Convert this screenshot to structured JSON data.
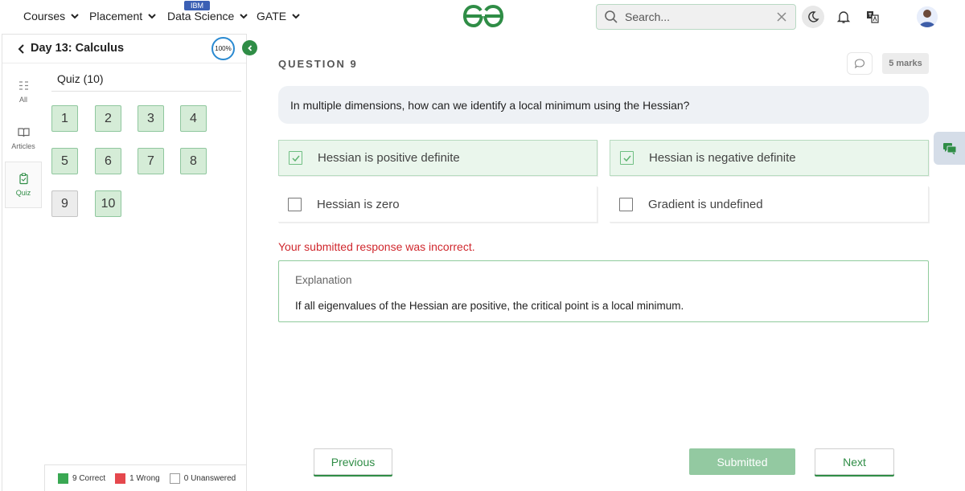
{
  "nav": {
    "items": [
      {
        "label": "Courses"
      },
      {
        "label": "Placement"
      },
      {
        "label": "Data Science",
        "badge": "IBM"
      },
      {
        "label": "GATE"
      }
    ],
    "search_placeholder": "Search...",
    "icons": {
      "logo": "gfg-logo-icon",
      "search": "search-icon",
      "clear": "close-icon",
      "theme": "moon-icon",
      "notifications": "bell-icon",
      "language": "translate-icon"
    },
    "brand_color": "#2f8d46"
  },
  "sidebar": {
    "title": "Day 13: Calculus",
    "progress": "100%",
    "tabs": [
      {
        "label": "All",
        "icon": "list-icon"
      },
      {
        "label": "Articles",
        "icon": "book-icon"
      },
      {
        "label": "Quiz",
        "icon": "clipboard-icon",
        "active": true
      }
    ],
    "quiz_label": "Quiz (10)",
    "questions": [
      {
        "num": "1",
        "status": "answered"
      },
      {
        "num": "2",
        "status": "answered"
      },
      {
        "num": "3",
        "status": "answered"
      },
      {
        "num": "4",
        "status": "answered"
      },
      {
        "num": "5",
        "status": "answered"
      },
      {
        "num": "6",
        "status": "answered"
      },
      {
        "num": "7",
        "status": "answered"
      },
      {
        "num": "8",
        "status": "answered"
      },
      {
        "num": "9",
        "status": "current"
      },
      {
        "num": "10",
        "status": "answered"
      }
    ],
    "legend": {
      "correct": "9 Correct",
      "wrong": "1 Wrong",
      "unanswered": "0 Unanswered",
      "colors": {
        "correct": "#3aa853",
        "wrong": "#e5484d",
        "unanswered": "#ffffff"
      }
    }
  },
  "main": {
    "question_heading": "QUESTION 9",
    "marks": "5 marks",
    "question_text": "In multiple dimensions, how can we identify a local minimum using the Hessian?",
    "options": [
      {
        "label": "Hessian is positive definite",
        "selected": true
      },
      {
        "label": "Hessian is negative definite",
        "selected": true
      },
      {
        "label": "Hessian is zero",
        "selected": false
      },
      {
        "label": "Gradient is undefined",
        "selected": false
      }
    ],
    "result_message": "Your submitted response was incorrect.",
    "result_color": "#d0282e",
    "explanation_title": "Explanation",
    "explanation_text": "If all eigenvalues of the Hessian are positive, the critical point is a local minimum.",
    "buttons": {
      "previous": "Previous",
      "submitted": "Submitted",
      "next": "Next"
    }
  }
}
